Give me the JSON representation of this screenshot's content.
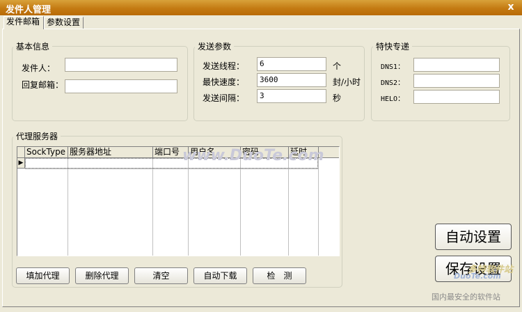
{
  "window": {
    "title": "发件人管理",
    "close": "x"
  },
  "tabs": [
    {
      "label": "发件邮箱"
    },
    {
      "label": "参数设置"
    }
  ],
  "basic": {
    "title": "基本信息",
    "sender_label": "发件人：",
    "sender_value": "",
    "reply_label": "回复邮箱：",
    "reply_value": ""
  },
  "send": {
    "title": "发送参数",
    "threads_label": "发送线程：",
    "threads_value": "6",
    "threads_unit": "个",
    "speed_label": "最快速度：",
    "speed_value": "3600",
    "speed_unit": "封/小时",
    "interval_label": "发送间隔：",
    "interval_value": "3",
    "interval_unit": "秒"
  },
  "express": {
    "title": "特快专递",
    "dns1_label": "DNS1：",
    "dns1_value": "",
    "dns2_label": "DNS2：",
    "dns2_value": "",
    "helo_label": "HELO：",
    "helo_value": ""
  },
  "proxy": {
    "title": "代理服务器",
    "columns": [
      "SockType",
      "服务器地址",
      "端口号",
      "用户名",
      "密码",
      "延时"
    ],
    "row_marker": "▶",
    "buttons": {
      "add": "填加代理",
      "delete": "删除代理",
      "clear": "清空",
      "download": "自动下载",
      "check": "检　测"
    }
  },
  "actions": {
    "auto": "自动设置",
    "save": "保存设置"
  },
  "watermark": {
    "site": "www.DuoTe.com",
    "brand": "多特软件站",
    "site2": "DuoTe.com",
    "slogan": "国内最安全的软件站"
  },
  "colors": {
    "title_bar": "#c47a12",
    "face": "#ece9d8"
  }
}
